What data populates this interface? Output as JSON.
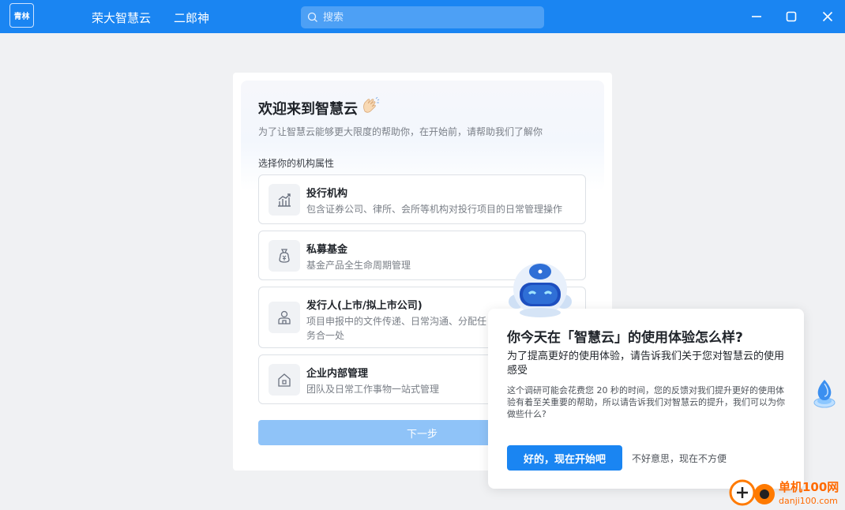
{
  "titlebar": {
    "avatar_text": "青林",
    "org_name": "荣大智慧云",
    "user_name": "二郎神",
    "search_placeholder": "搜索",
    "window_controls": [
      "minimize-icon",
      "maximize-icon",
      "close-icon"
    ]
  },
  "welcome": {
    "title": "欢迎来到智慧云",
    "title_icon": "clapping-hands-icon",
    "subtitle": "为了让智慧云能够更大限度的帮助你，在开始前，请帮助我们了解你",
    "section_label": "选择你的机构属性",
    "options": [
      {
        "icon": "chart-icon",
        "title": "投行机构",
        "desc": "包含证券公司、律所、会所等机构对投行项目的日常管理操作"
      },
      {
        "icon": "money-bag-icon",
        "title": "私募基金",
        "desc": "基金产品全生命周期管理"
      },
      {
        "icon": "person-icon",
        "title": "发行人(上市/拟上市公司)",
        "desc": "项目申报中的文件传递、日常沟通、分配任务合一处"
      },
      {
        "icon": "house-icon",
        "title": "企业内部管理",
        "desc": "团队及日常工作事物一站式管理"
      }
    ],
    "next_label": "下一步"
  },
  "survey": {
    "title": "你今天在「智慧云」的使用体验怎么样?",
    "subtitle": "为了提高更好的使用体验，请告诉我们关于您对智慧云的使用感受",
    "body": "这个调研可能会花费您 20 秒的时间，您的反馈对我们提升更好的使用体验有着至关重要的帮助，所以请告诉我们对智慧云的提升，我们可以为你做些什么?",
    "accept_label": "好的，现在开始吧",
    "decline_label": "不好意思，现在不方便"
  },
  "watermark": {
    "title": "单机100网",
    "url": "danji100.com"
  },
  "colors": {
    "brand": "#1a85f2",
    "next_disabled": "#8fc3f8"
  }
}
